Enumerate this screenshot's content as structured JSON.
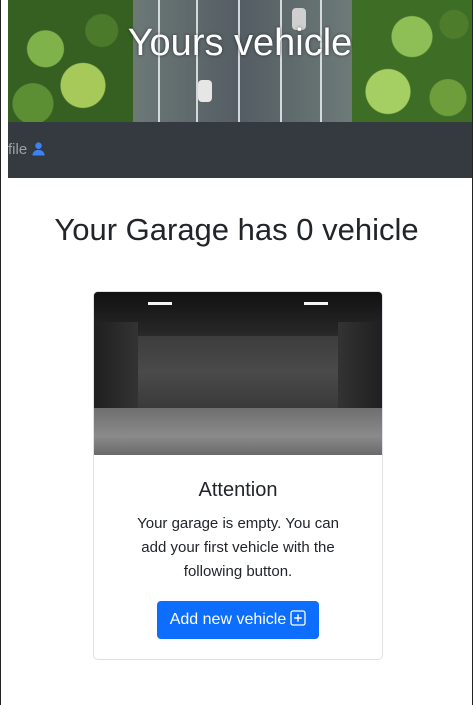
{
  "hero": {
    "title": "Yours vehicle"
  },
  "navbar": {
    "profile_label": "file",
    "profile_icon": "person-icon"
  },
  "main": {
    "title": "Your Garage has 0 vehicle"
  },
  "card": {
    "image_icon": "empty-garage-image",
    "title": "Attention",
    "text": "Your garage is empty. You can add your first vehicle with the following button.",
    "button_label": "Add new vehicle",
    "button_icon": "plus-square-icon"
  },
  "colors": {
    "navbar_bg": "#343a40",
    "button_bg": "#0d6efd",
    "text": "#212529"
  }
}
